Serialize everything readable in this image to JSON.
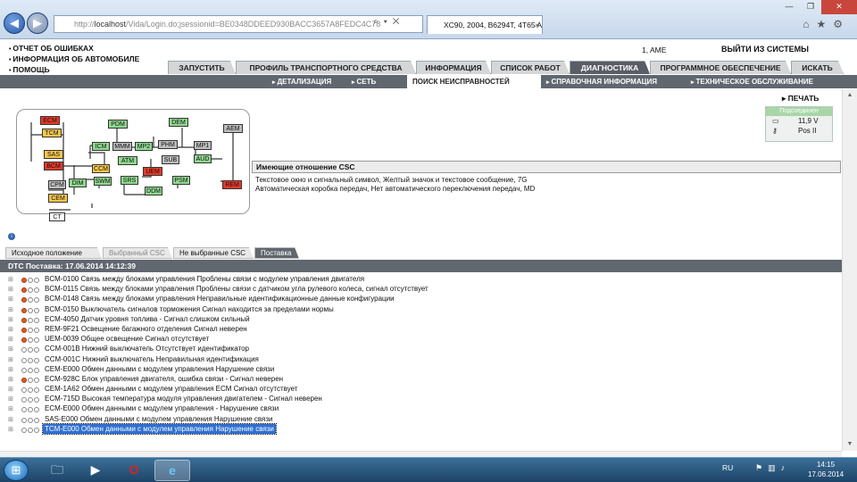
{
  "browser": {
    "url_prefix": "http://",
    "url_host": "localhost",
    "url_path": "/Vida/Login.do;jsessionid=BE0348DDEED930BACC3657A8FEDC4C78",
    "tab_title": "XC90, 2004, B6294T, 4T65 A...",
    "tab_close": "×",
    "win_min": "—",
    "win_max": "❐",
    "win_close": "✕",
    "icons": [
      "home-icon",
      "star-icon",
      "gear-icon"
    ]
  },
  "menu": {
    "items": [
      "ОТЧЕТ ОБ ОШИБКАХ",
      "ИНФОРМАЦИЯ ОБ АВТОМОБИЛЕ",
      "ПОМОЩЬ"
    ],
    "user": "1, AME",
    "logout": "ВЫЙТИ ИЗ СИСТЕМЫ"
  },
  "main_tabs": [
    "ЗАПУСТИТЬ",
    "ПРОФИЛЬ ТРАНСПОРТНОГО СРЕДСТВА",
    "ИНФОРМАЦИЯ",
    "СПИСОК РАБОТ",
    "ДИАГНОСТИКА",
    "ПРОГРАММНОЕ ОБЕСПЕЧЕНИЕ",
    "ИСКАТЬ"
  ],
  "main_tab_active": "ДИАГНОСТИКА",
  "sub_tabs": [
    "ДЕТАЛИЗАЦИЯ",
    "СЕТЬ",
    "ПОИСК НЕИСПРАВНОСТЕЙ",
    "СПРАВОЧНАЯ ИНФОРМАЦИЯ",
    "ТЕХНИЧЕСКОЕ ОБСЛУЖИВАНИЕ"
  ],
  "sub_tab_active": "ПОИСК НЕИСПРАВНОСТЕЙ",
  "network": {
    "nodes": [
      {
        "label": "ECM",
        "status": "red"
      },
      {
        "label": "TCM",
        "status": "yellow"
      },
      {
        "label": "PDM",
        "status": "green"
      },
      {
        "label": "DEM",
        "status": "green"
      },
      {
        "label": "AEM",
        "status": "gray"
      },
      {
        "label": "ICM",
        "status": "green"
      },
      {
        "label": "MMM",
        "status": "gray"
      },
      {
        "label": "MP2",
        "status": "green"
      },
      {
        "label": "PHM",
        "status": "gray"
      },
      {
        "label": "MP1",
        "status": "gray"
      },
      {
        "label": "SAS",
        "status": "yellow"
      },
      {
        "label": "BCM",
        "status": "red"
      },
      {
        "label": "ATM",
        "status": "green"
      },
      {
        "label": "SUB",
        "status": "gray"
      },
      {
        "label": "AUD",
        "status": "green"
      },
      {
        "label": "CCM",
        "status": "yellow"
      },
      {
        "label": "UEM",
        "status": "red"
      },
      {
        "label": "SWM",
        "status": "green"
      },
      {
        "label": "SRS",
        "status": "green"
      },
      {
        "label": "PSM",
        "status": "green"
      },
      {
        "label": "REM",
        "status": "red"
      },
      {
        "label": "CPM",
        "status": "gray"
      },
      {
        "label": "DIM",
        "status": "green"
      },
      {
        "label": "DDM",
        "status": "green"
      },
      {
        "label": "CEM",
        "status": "yellow"
      },
      {
        "label": "CT",
        "status": "white"
      }
    ]
  },
  "print_label": "ПЕЧАТЬ",
  "status_box": {
    "header": "Подсоединен",
    "voltage": "11,9 V",
    "ignition": "Pos II"
  },
  "csc": {
    "header": "Имеющие отношение CSC",
    "lines": [
      "Текстовое окно и сигнальный символ, Желтый значок и текстовое сообщение, 7G",
      "Автоматическая коробка передач, Нет автоматического переключения передач, MD"
    ]
  },
  "bottom_tabs": [
    "Исходное положение",
    "Выбранный CSC",
    "Не выбранные CSC",
    "Поставка"
  ],
  "bottom_tab_active": "Поставка",
  "dtc_header": "DTC Поставка: 17.06.2014 14:12:39",
  "dtcs": [
    {
      "text": "BCM-0100 Связь между блоками управления Проблены связи с модулем управления двигателя",
      "active": true
    },
    {
      "text": "BCM-0115 Связь между блоками управления Проблены связи с датчиком угла рулевого колеса, сигнал отсутствует",
      "active": true
    },
    {
      "text": "BCM-0148 Связь между блоками управления Неправильные идентификационные данные конфигурации",
      "active": true
    },
    {
      "text": "BCM-0150 Выключатель сигналов торможения Сигнал находится за пределами нормы",
      "active": true
    },
    {
      "text": "ECM-4050 Датчик уровня топлива - Сигнал слишком сильный",
      "active": true
    },
    {
      "text": "REM-9F21 Освещение багажного отделения Сигнал неверен",
      "active": true
    },
    {
      "text": "UEM-0039 Общее освещение Сигнал отсутствует",
      "active": true
    },
    {
      "text": "CCM-001B Нижний выключатель Отсутствует идентификатор",
      "active": false
    },
    {
      "text": "CCM-001C Нижний выключатель Неправильная идентификация",
      "active": false
    },
    {
      "text": "CEM-E000 Обмен данными с модулем управления Нарушение связи",
      "active": false
    },
    {
      "text": "ECM-928C Блок управления двигателя, ошибка связи - Сигнал неверен",
      "active": true
    },
    {
      "text": "CEM-1A62 Обмен данными с модулем управления ECM Сигнал отсутствует",
      "active": false
    },
    {
      "text": "ECM-715D Высокая температура модуля управления двигателем - Сигнал неверен",
      "active": false
    },
    {
      "text": "ECM-E000 Обмен данными с модулем управления - Нарушение связи",
      "active": false
    },
    {
      "text": "SAS-E000 Обмен данными с модулем управления Нарушение связи",
      "active": false
    },
    {
      "text": "TCM-E000 Обмен данными с модулем управления Нарушение связи",
      "active": false,
      "selected": true
    }
  ],
  "taskbar": {
    "lang": "RU",
    "time": "14:15",
    "date": "17.06.2014"
  }
}
